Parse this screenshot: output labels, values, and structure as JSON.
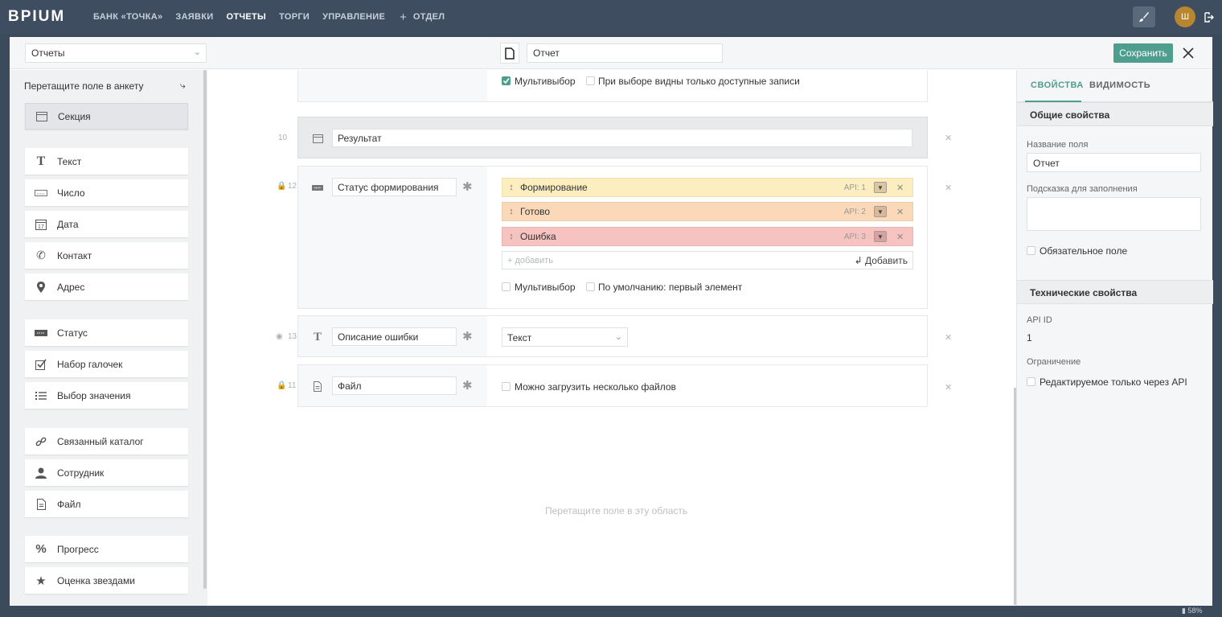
{
  "nav": {
    "logo": "BPIUM",
    "items": [
      "БАНК «ТОЧКА»",
      "ЗАЯВКИ",
      "ОТЧЕТЫ",
      "ТОРГИ",
      "УПРАВЛЕНИЕ"
    ],
    "active_index": 2,
    "add_section": "ОТДЕЛ",
    "avatar_letter": "Ш"
  },
  "toolbar": {
    "catalog": "Отчеты",
    "title_value": "Отчет",
    "save_label": "Сохранить"
  },
  "palette": {
    "header": "Перетащите поле в анкету",
    "items": [
      {
        "label": "Секция",
        "icon": "section-icon"
      },
      {
        "label": "Текст",
        "icon": "text-icon"
      },
      {
        "label": "Число",
        "icon": "number-icon"
      },
      {
        "label": "Дата",
        "icon": "calendar-icon"
      },
      {
        "label": "Контакт",
        "icon": "phone-icon"
      },
      {
        "label": "Адрес",
        "icon": "map-pin-icon"
      },
      {
        "label": "Статус",
        "icon": "status-icon"
      },
      {
        "label": "Набор галочек",
        "icon": "checkbox-icon"
      },
      {
        "label": "Выбор значения",
        "icon": "list-icon"
      },
      {
        "label": "Связанный каталог",
        "icon": "link-icon"
      },
      {
        "label": "Сотрудник",
        "icon": "user-icon"
      },
      {
        "label": "Файл",
        "icon": "file-icon"
      },
      {
        "label": "Прогресс",
        "icon": "percent-icon"
      },
      {
        "label": "Оценка звездами",
        "icon": "star-icon"
      }
    ]
  },
  "form": {
    "top_row": {
      "multi": "Мультивыбор",
      "multi_checked": true,
      "only_available": "При выборе видны только доступные записи"
    },
    "section": {
      "num": "10",
      "title": "Результат"
    },
    "status_field": {
      "num": "12",
      "name": "Статус формирования",
      "options": [
        {
          "label": "Формирование",
          "api": "API: 1",
          "color": "#fdeec0"
        },
        {
          "label": "Готово",
          "api": "API: 2",
          "color": "#fbd9b8"
        },
        {
          "label": "Ошибка",
          "api": "API: 3",
          "color": "#f6c3c0"
        }
      ],
      "add_placeholder": "+ добавить",
      "add_button": "Добавить",
      "multi": "Мультивыбор",
      "default_first": "По умолчанию: первый элемент"
    },
    "error_field": {
      "num": "13",
      "name": "Описание ошибки",
      "type": "Текст"
    },
    "file_field": {
      "num": "11",
      "name": "Файл",
      "multi_files": "Можно загрузить несколько файлов"
    },
    "dropzone": "Перетащите поле в эту область"
  },
  "props": {
    "tabs": [
      "СВОЙСТВА",
      "ВИДИМОСТЬ"
    ],
    "general_title": "Общие свойства",
    "field_name_label": "Название поля",
    "field_name_value": "Отчет",
    "hint_label": "Подсказка для заполнения",
    "hint_value": "",
    "required_label": "Обязательное поле",
    "tech_title": "Технические свойства",
    "api_id_label": "API ID",
    "api_id_value": "1",
    "restriction_label": "Ограничение",
    "api_only_label": "Редактируемое только через API"
  },
  "status_bar": {
    "battery": "58%"
  }
}
